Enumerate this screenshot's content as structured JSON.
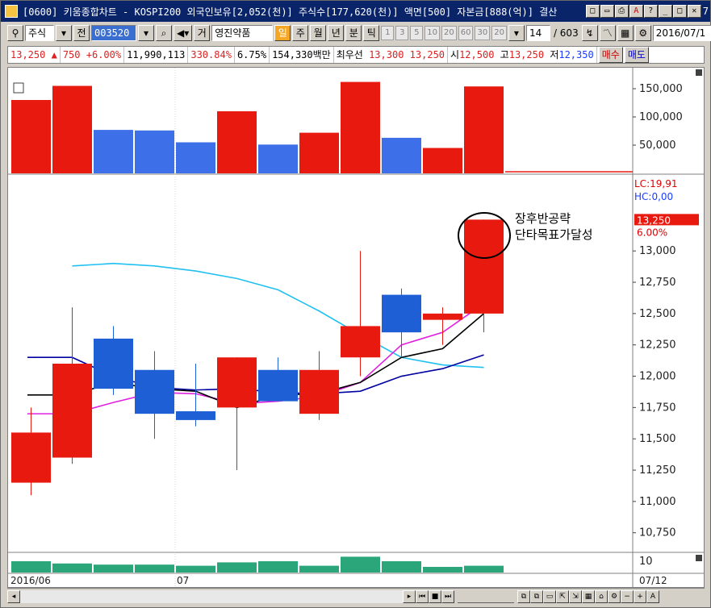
{
  "window": {
    "title": "[0600] 키움종합차트 - KOSPI200 외국인보유[2,052(천)] 주식수[177,620(천)] 액면[500] 자본금[888(억)] 결산",
    "trailing_label": "7"
  },
  "toolbar": {
    "market_label": "주식",
    "whole_label": "전",
    "stock_code": "003520",
    "broker_label": "거",
    "stock_name": "영진약품",
    "period_tabs": [
      {
        "label": "일",
        "selected": true
      },
      {
        "label": "주",
        "selected": false
      },
      {
        "label": "월",
        "selected": false
      },
      {
        "label": "년",
        "selected": false
      },
      {
        "label": "분",
        "selected": false
      },
      {
        "label": "틱",
        "selected": false
      }
    ],
    "intervals": [
      "1",
      "3",
      "5",
      "10",
      "20",
      "60",
      "30",
      "20"
    ],
    "count_value": "14",
    "count_total": "/ 603",
    "date_value": "2016/07/1"
  },
  "quote": {
    "price": "13,250",
    "change_arrow": "▲",
    "change": "750",
    "change_pct": "+6.00%",
    "volume": "11,990,113",
    "volume_ratio": "330.84%",
    "turnover": "6.75%",
    "amount": "154,330백만",
    "priority_label": "최우선",
    "best_ask": "13,300",
    "best_bid": "13,250",
    "open_label": "시",
    "open": "12,500",
    "high_label": "고",
    "high": "13,250",
    "low_label": "저",
    "low": "12,350",
    "buy_button": "매수",
    "sell_button": "매도"
  },
  "colors": {
    "up": "#e8190f",
    "down": "#1f5fd6",
    "vol_up": "#e8190f",
    "vol_down": "#3d6fe8",
    "ma5": "#000000",
    "ma10": "#e020e0",
    "ma20": "#0000a0",
    "ma60": "#20c0f0",
    "sub_vol": "#2aa67a",
    "limit_label": "#e00000"
  },
  "chart_data": {
    "type": "candlestick",
    "x_label_start": "2016/06",
    "x_label_mid": "07",
    "x_label_end": "07/12",
    "price_axis": {
      "ticks": [
        "13,000",
        "12,750",
        "12,500",
        "12,250",
        "12,000",
        "11,750",
        "11,500",
        "11,250",
        "11,000",
        "10,750"
      ],
      "tick_values": [
        13000,
        12750,
        12500,
        12250,
        12000,
        11750,
        11500,
        11250,
        11000,
        10750
      ],
      "range": [
        10600,
        13600
      ]
    },
    "volume_axis": {
      "ticks": [
        "150,000",
        "100,000",
        "50,000"
      ],
      "tick_values": [
        150000,
        100000,
        50000
      ],
      "range": [
        0,
        170000
      ]
    },
    "sub_axis": {
      "ticks": [
        "10"
      ]
    },
    "candles": [
      {
        "open": 11150,
        "high": 11750,
        "low": 11050,
        "close": 11550,
        "volume": 130000,
        "sub": 10
      },
      {
        "open": 11350,
        "high": 12550,
        "low": 11300,
        "close": 12100,
        "volume": 155000,
        "sub": 8
      },
      {
        "open": 12300,
        "high": 12400,
        "low": 11850,
        "close": 11900,
        "volume": 77000,
        "sub": 7
      },
      {
        "open": 12050,
        "high": 12200,
        "low": 11500,
        "close": 11700,
        "volume": 76000,
        "sub": 7
      },
      {
        "open": 11720,
        "high": 12100,
        "low": 11600,
        "close": 11650,
        "volume": 55000,
        "sub": 6
      },
      {
        "open": 11750,
        "high": 12150,
        "low": 11250,
        "close": 12150,
        "volume": 110000,
        "sub": 9
      },
      {
        "open": 12050,
        "high": 12150,
        "low": 11800,
        "close": 11800,
        "volume": 51000,
        "sub": 10
      },
      {
        "open": 11700,
        "high": 12200,
        "low": 11650,
        "close": 12050,
        "volume": 72000,
        "sub": 6
      },
      {
        "open": 12150,
        "high": 13000,
        "low": 12000,
        "close": 12400,
        "volume": 162000,
        "sub": 14
      },
      {
        "open": 12650,
        "high": 12700,
        "low": 12150,
        "close": 12350,
        "volume": 63000,
        "sub": 10
      },
      {
        "open": 12450,
        "high": 12550,
        "low": 12250,
        "close": 12500,
        "volume": 45000,
        "sub": 5
      },
      {
        "open": 12500,
        "high": 13250,
        "low": 12350,
        "close": 13250,
        "volume": 154000,
        "sub": 6
      }
    ],
    "ma5": [
      null,
      11850,
      11950,
      11900,
      11880,
      11750,
      11850,
      11860,
      11950,
      12150,
      12220,
      12500
    ],
    "ma10": [
      null,
      11700,
      11790,
      11870,
      11860,
      11780,
      11800,
      11840,
      11950,
      12250,
      12350,
      12580
    ],
    "ma20": [
      null,
      12150,
      12000,
      11910,
      11890,
      11900,
      11870,
      11860,
      11880,
      12000,
      12060,
      12170
    ],
    "ma60": [
      null,
      12880,
      12900,
      12880,
      12840,
      12780,
      12690,
      12520,
      12330,
      12150,
      12090,
      12070
    ],
    "limit_line_label": "LC:19,91",
    "hc_label": "HC:0,00",
    "last_price_label": "13,250",
    "last_pct_label": "6.00%",
    "annotation": [
      "장후반공략",
      "단타목표가달성"
    ]
  }
}
